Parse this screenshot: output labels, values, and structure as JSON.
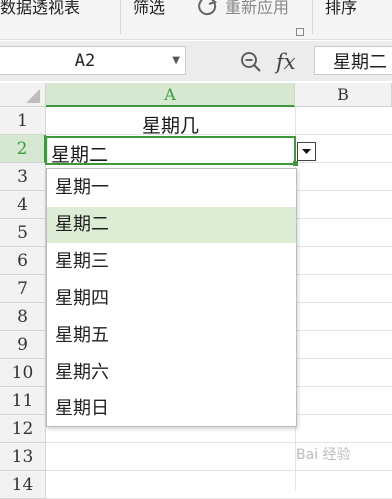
{
  "ribbon": {
    "items": [
      {
        "label": "数据透视表"
      },
      {
        "label": "筛选"
      },
      {
        "label": "重新应用"
      },
      {
        "label": "排序"
      }
    ]
  },
  "formula_bar": {
    "name_box": "A2",
    "fx_label": "fx",
    "content": "星期二"
  },
  "sheet": {
    "columns": [
      "A",
      "B"
    ],
    "rows": [
      "1",
      "2",
      "3",
      "4",
      "5",
      "6",
      "7",
      "8",
      "9",
      "10",
      "11",
      "12",
      "13",
      "14"
    ],
    "cells": {
      "A1": "星期几",
      "A2": "星期二"
    },
    "active_cell": "A2",
    "accent_color": "#3c9a3c"
  },
  "dropdown": {
    "options": [
      "星期一",
      "星期二",
      "星期三",
      "星期四",
      "星期五",
      "星期六",
      "星期日"
    ],
    "selected": "星期二",
    "highlight_color": "#dcecd5"
  },
  "icons": {
    "zoom": "zoom-out-icon",
    "reapply": "reapply-icon",
    "dropdown_arrow": "chevron-down-icon"
  },
  "watermark": "Bai 经验"
}
